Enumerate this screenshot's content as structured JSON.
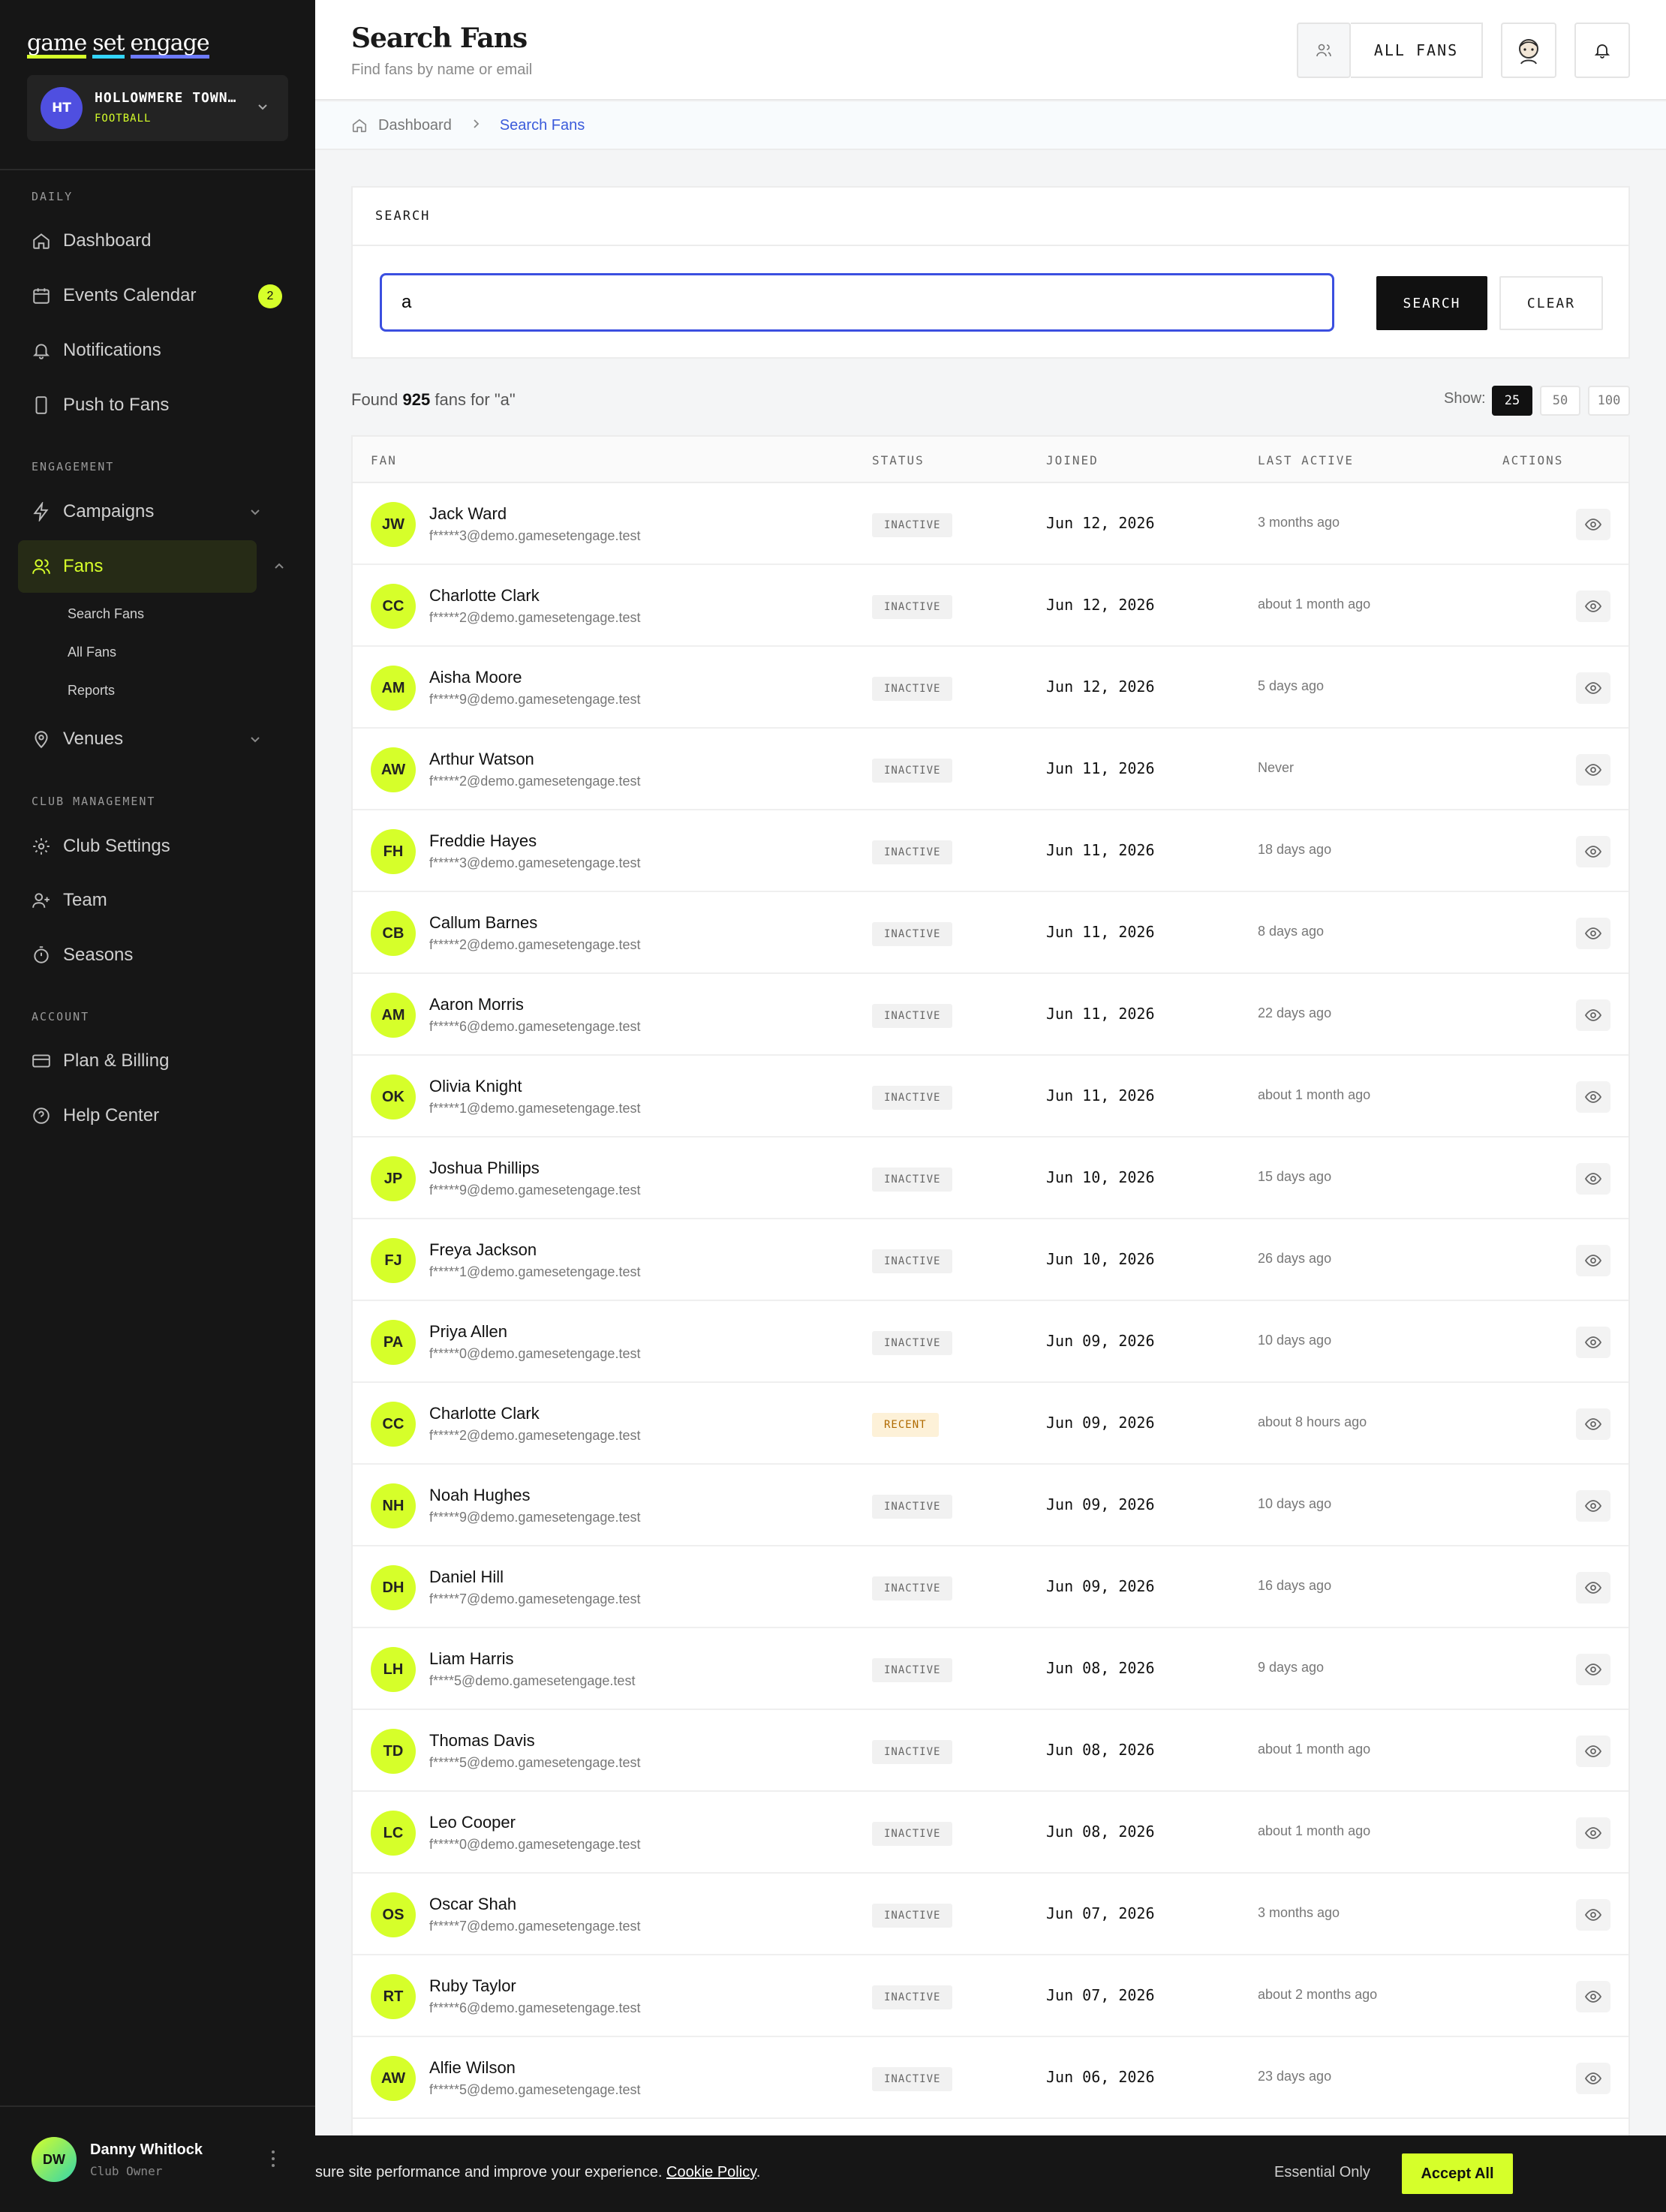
{
  "brand": {
    "w1": "game",
    "w2": "set",
    "w3": "engage"
  },
  "club": {
    "initials": "HT",
    "name": "HOLLOWMERE TOWN…",
    "sport": "FOOTBALL"
  },
  "sections": {
    "daily": "DAILY",
    "engagement": "ENGAGEMENT",
    "club_management": "CLUB MANAGEMENT",
    "account": "ACCOUNT"
  },
  "nav": {
    "dashboard": "Dashboard",
    "events_calendar": "Events Calendar",
    "events_count": "2",
    "notifications": "Notifications",
    "push_to_fans": "Push to Fans",
    "campaigns": "Campaigns",
    "fans": "Fans",
    "fans_sub": [
      "Search Fans",
      "All Fans",
      "Reports"
    ],
    "venues": "Venues",
    "club_settings": "Club Settings",
    "team": "Team",
    "seasons": "Seasons",
    "plan_billing": "Plan & Billing",
    "help_center": "Help Center"
  },
  "user": {
    "initials": "DW",
    "name": "Danny Whitlock",
    "role": "Club Owner"
  },
  "header": {
    "title": "Search Fans",
    "subtitle": "Find fans by name or email",
    "all_fans": "ALL FANS"
  },
  "breadcrumb": {
    "home": "Dashboard",
    "current": "Search Fans"
  },
  "search": {
    "card_title": "SEARCH",
    "value": "a",
    "search_btn": "SEARCH",
    "clear_btn": "CLEAR"
  },
  "results": {
    "prefix": "Found",
    "count": "925",
    "suffix": "fans for \"a\"",
    "show_label": "Show:",
    "page_sizes": [
      "25",
      "50",
      "100"
    ],
    "selected_size": "25"
  },
  "table": {
    "columns": [
      "FAN",
      "STATUS",
      "JOINED",
      "LAST ACTIVE",
      "ACTIONS"
    ],
    "rows": [
      {
        "initials": "JW",
        "name": "Jack Ward",
        "email": "f*****3@demo.gamesetengage.test",
        "status": "INACTIVE",
        "joined": "Jun 12, 2026",
        "last_active": "3 months ago"
      },
      {
        "initials": "CC",
        "name": "Charlotte Clark",
        "email": "f*****2@demo.gamesetengage.test",
        "status": "INACTIVE",
        "joined": "Jun 12, 2026",
        "last_active": "about 1 month ago"
      },
      {
        "initials": "AM",
        "name": "Aisha Moore",
        "email": "f*****9@demo.gamesetengage.test",
        "status": "INACTIVE",
        "joined": "Jun 12, 2026",
        "last_active": "5 days ago"
      },
      {
        "initials": "AW",
        "name": "Arthur Watson",
        "email": "f*****2@demo.gamesetengage.test",
        "status": "INACTIVE",
        "joined": "Jun 11, 2026",
        "last_active": "Never"
      },
      {
        "initials": "FH",
        "name": "Freddie Hayes",
        "email": "f*****3@demo.gamesetengage.test",
        "status": "INACTIVE",
        "joined": "Jun 11, 2026",
        "last_active": "18 days ago"
      },
      {
        "initials": "CB",
        "name": "Callum Barnes",
        "email": "f*****2@demo.gamesetengage.test",
        "status": "INACTIVE",
        "joined": "Jun 11, 2026",
        "last_active": "8 days ago"
      },
      {
        "initials": "AM",
        "name": "Aaron Morris",
        "email": "f*****6@demo.gamesetengage.test",
        "status": "INACTIVE",
        "joined": "Jun 11, 2026",
        "last_active": "22 days ago"
      },
      {
        "initials": "OK",
        "name": "Olivia Knight",
        "email": "f*****1@demo.gamesetengage.test",
        "status": "INACTIVE",
        "joined": "Jun 11, 2026",
        "last_active": "about 1 month ago"
      },
      {
        "initials": "JP",
        "name": "Joshua Phillips",
        "email": "f*****9@demo.gamesetengage.test",
        "status": "INACTIVE",
        "joined": "Jun 10, 2026",
        "last_active": "15 days ago"
      },
      {
        "initials": "FJ",
        "name": "Freya Jackson",
        "email": "f*****1@demo.gamesetengage.test",
        "status": "INACTIVE",
        "joined": "Jun 10, 2026",
        "last_active": "26 days ago"
      },
      {
        "initials": "PA",
        "name": "Priya Allen",
        "email": "f*****0@demo.gamesetengage.test",
        "status": "INACTIVE",
        "joined": "Jun 09, 2026",
        "last_active": "10 days ago"
      },
      {
        "initials": "CC",
        "name": "Charlotte Clark",
        "email": "f*****2@demo.gamesetengage.test",
        "status": "RECENT",
        "joined": "Jun 09, 2026",
        "last_active": "about 8 hours ago"
      },
      {
        "initials": "NH",
        "name": "Noah Hughes",
        "email": "f*****9@demo.gamesetengage.test",
        "status": "INACTIVE",
        "joined": "Jun 09, 2026",
        "last_active": "10 days ago"
      },
      {
        "initials": "DH",
        "name": "Daniel Hill",
        "email": "f*****7@demo.gamesetengage.test",
        "status": "INACTIVE",
        "joined": "Jun 09, 2026",
        "last_active": "16 days ago"
      },
      {
        "initials": "LH",
        "name": "Liam Harris",
        "email": "f****5@demo.gamesetengage.test",
        "status": "INACTIVE",
        "joined": "Jun 08, 2026",
        "last_active": "9 days ago"
      },
      {
        "initials": "TD",
        "name": "Thomas Davis",
        "email": "f*****5@demo.gamesetengage.test",
        "status": "INACTIVE",
        "joined": "Jun 08, 2026",
        "last_active": "about 1 month ago"
      },
      {
        "initials": "LC",
        "name": "Leo Cooper",
        "email": "f*****0@demo.gamesetengage.test",
        "status": "INACTIVE",
        "joined": "Jun 08, 2026",
        "last_active": "about 1 month ago"
      },
      {
        "initials": "OS",
        "name": "Oscar Shah",
        "email": "f*****7@demo.gamesetengage.test",
        "status": "INACTIVE",
        "joined": "Jun 07, 2026",
        "last_active": "3 months ago"
      },
      {
        "initials": "RT",
        "name": "Ruby Taylor",
        "email": "f*****6@demo.gamesetengage.test",
        "status": "INACTIVE",
        "joined": "Jun 07, 2026",
        "last_active": "about 2 months ago"
      },
      {
        "initials": "AW",
        "name": "Alfie Wilson",
        "email": "f*****5@demo.gamesetengage.test",
        "status": "INACTIVE",
        "joined": "Jun 06, 2026",
        "last_active": "23 days ago"
      }
    ]
  },
  "cookie": {
    "message": "sure site performance and improve your experience.",
    "link": "Cookie Policy",
    "period": ".",
    "essential": "Essential Only",
    "accept": "Accept All"
  },
  "colors": {
    "accent": "#d6ff2a",
    "sidebar_bg": "#161616",
    "focus_blue": "#3b4fe0",
    "link_blue": "#3b5bdb",
    "recent_badge": "#fdf1d8"
  }
}
